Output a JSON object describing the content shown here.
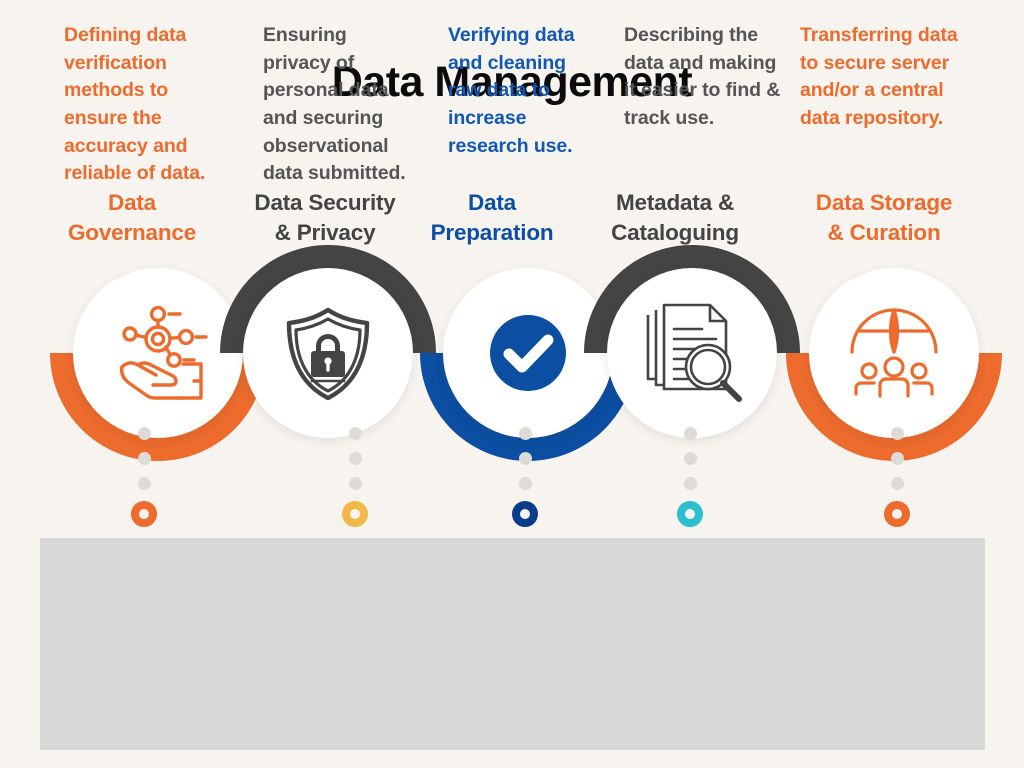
{
  "title": "Data Management",
  "colors": {
    "background": "#F7F3EF",
    "panel": "#D8D8D8",
    "orange": "#EC6B2D",
    "dark_gray": "#444444",
    "blue": "#0B4EA2",
    "text_gray": "#555555",
    "yellow": "#F0B849",
    "cyan": "#2BBFD0",
    "dot_gray": "#DEDAD5",
    "white": "#FFFFFF"
  },
  "steps": [
    {
      "heading": "Data\nGovernance",
      "heading_color": "#EC6B2D",
      "icon": "network-hand-icon",
      "arc_color": "#EC6B2D",
      "arc_position": "bottom",
      "ring_color": "#EC6B2D",
      "description": " Defining data verification methods to ensure the accuracy and reliable of data.",
      "description_color": "#EC6B2D"
    },
    {
      "heading": "Data Security\n& Privacy",
      "heading_color": "#444444",
      "icon": "shield-lock-icon",
      "arc_color": "#444444",
      "arc_position": "top",
      "ring_color": "#F0B849",
      "description": " Ensuring privacy of personal data and securing observational data submitted.",
      "description_color": "#555555"
    },
    {
      "heading": "Data\nPreparation",
      "heading_color": "#0B4EA2",
      "icon": "check-circle-icon",
      "arc_color": "#0B4EA2",
      "arc_position": "bottom",
      "ring_color": "#0B3C8C",
      "description": " Verifying data and cleaning raw data to increase research use.",
      "description_color": "#1158B5"
    },
    {
      "heading": "Metadata &\nCataloguing",
      "heading_color": "#444444",
      "icon": "document-search-icon",
      "arc_color": "#444444",
      "arc_position": "top",
      "ring_color": "#2BBFD0",
      "description": "Describing the data and making it easier to find & track use.",
      "description_color": "#555555"
    },
    {
      "heading": "Data Storage\n& Curation",
      "heading_color": "#EC6B2D",
      "icon": "globe-people-icon",
      "arc_color": "#EC6B2D",
      "arc_position": "bottom",
      "ring_color": "#EC6B2D",
      "description": "Transferring data to secure server and/or a central data repository.",
      "description_color": "#EC6B2D"
    }
  ]
}
